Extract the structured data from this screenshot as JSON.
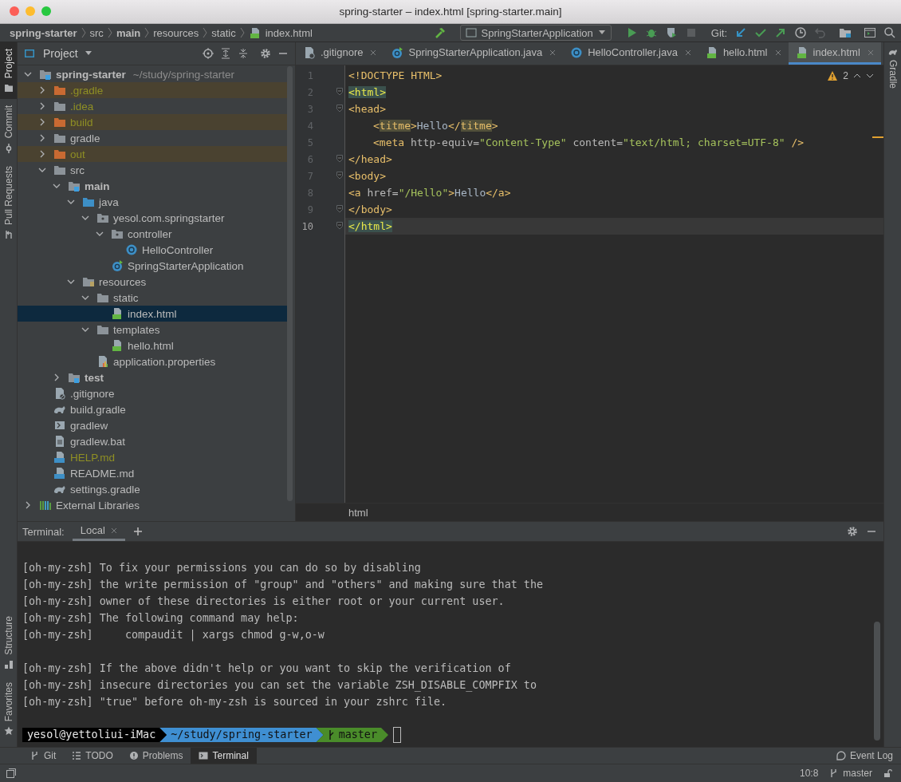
{
  "window": {
    "title": "spring-starter – index.html [spring-starter.main]"
  },
  "navbar": {
    "breadcrumbs": [
      {
        "label": "spring-starter",
        "bold": true
      },
      {
        "label": "src",
        "bold": false
      },
      {
        "label": "main",
        "bold": true
      },
      {
        "label": "resources",
        "bold": false
      },
      {
        "label": "static",
        "bold": false
      },
      {
        "label": "index.html",
        "bold": false
      }
    ],
    "run_config": "SpringStarterApplication",
    "git_label": "Git:"
  },
  "left_strip": {
    "top": [
      {
        "label": "Project",
        "selected": true
      },
      {
        "label": "Commit",
        "selected": false
      },
      {
        "label": "Pull Requests",
        "selected": false
      }
    ],
    "bottom": [
      {
        "label": "Structure",
        "selected": false
      },
      {
        "label": "Favorites",
        "selected": false
      }
    ]
  },
  "right_strip": [
    {
      "label": "Gradle",
      "selected": false
    }
  ],
  "project": {
    "title": "Project",
    "tree": [
      {
        "name": "spring-starter",
        "path": "~/study/spring-starter",
        "kind": "module",
        "expanded": true,
        "selected": false,
        "children": [
          {
            "name": ".gradle",
            "kind": "folder",
            "expanded": false,
            "excluded": true,
            "ignored": true,
            "selected": false
          },
          {
            "name": ".idea",
            "kind": "folder",
            "expanded": false,
            "excluded": false,
            "ignored": true,
            "selected": false
          },
          {
            "name": "build",
            "kind": "folder",
            "expanded": false,
            "excluded": true,
            "ignored": true,
            "selected": false
          },
          {
            "name": "gradle",
            "kind": "folder",
            "expanded": false,
            "excluded": false,
            "ignored": false,
            "selected": false
          },
          {
            "name": "out",
            "kind": "folder",
            "expanded": false,
            "excluded": true,
            "ignored": true,
            "selected": false
          },
          {
            "name": "src",
            "kind": "folder",
            "expanded": true,
            "selected": false,
            "children": [
              {
                "name": "main",
                "kind": "module",
                "expanded": true,
                "selected": false,
                "children": [
                  {
                    "name": "java",
                    "kind": "source",
                    "expanded": true,
                    "selected": false,
                    "children": [
                      {
                        "name": "yesol.com.springstarter",
                        "kind": "package",
                        "expanded": true,
                        "selected": false,
                        "children": [
                          {
                            "name": "controller",
                            "kind": "package",
                            "expanded": true,
                            "selected": false,
                            "children": [
                              {
                                "name": "HelloController",
                                "kind": "class",
                                "selected": false
                              }
                            ]
                          },
                          {
                            "name": "SpringStarterApplication",
                            "kind": "app",
                            "selected": false
                          }
                        ]
                      }
                    ]
                  },
                  {
                    "name": "resources",
                    "kind": "resources",
                    "expanded": true,
                    "selected": false,
                    "children": [
                      {
                        "name": "static",
                        "kind": "folder",
                        "expanded": true,
                        "selected": false,
                        "children": [
                          {
                            "name": "index.html",
                            "kind": "html",
                            "selected": true
                          }
                        ]
                      },
                      {
                        "name": "templates",
                        "kind": "folder",
                        "expanded": true,
                        "selected": false,
                        "children": [
                          {
                            "name": "hello.html",
                            "kind": "html",
                            "selected": false
                          }
                        ]
                      },
                      {
                        "name": "application.properties",
                        "kind": "properties",
                        "selected": false
                      }
                    ]
                  }
                ]
              },
              {
                "name": "test",
                "kind": "module",
                "expanded": false,
                "selected": false
              }
            ]
          },
          {
            "name": ".gitignore",
            "kind": "gitignore",
            "selected": false
          },
          {
            "name": "build.gradle",
            "kind": "gradle",
            "selected": false
          },
          {
            "name": "gradlew",
            "kind": "script",
            "selected": false
          },
          {
            "name": "gradlew.bat",
            "kind": "file",
            "selected": false
          },
          {
            "name": "HELP.md",
            "kind": "md",
            "ignored": true,
            "selected": false
          },
          {
            "name": "README.md",
            "kind": "md",
            "ignored": false,
            "selected": false
          },
          {
            "name": "settings.gradle",
            "kind": "gradle",
            "selected": false
          }
        ]
      },
      {
        "name": "External Libraries",
        "kind": "library",
        "expanded": false,
        "selected": false
      }
    ]
  },
  "editor": {
    "tabs": [
      {
        "label": ".gitignore",
        "kind": "gitignore",
        "selected": false
      },
      {
        "label": "SpringStarterApplication.java",
        "kind": "app",
        "selected": false
      },
      {
        "label": "HelloController.java",
        "kind": "class",
        "selected": false
      },
      {
        "label": "hello.html",
        "kind": "html",
        "selected": false
      },
      {
        "label": "index.html",
        "kind": "html",
        "selected": true
      }
    ],
    "warnings": "2",
    "lines": [
      {
        "number": "1",
        "fold": false,
        "current": false,
        "indented": false,
        "tokens": [
          {
            "text": "<!DOCTYPE HTML>",
            "kind": "tag"
          }
        ]
      },
      {
        "number": "2",
        "fold": true,
        "current": false,
        "indented": false,
        "tokens": [
          {
            "text": "<html>",
            "kind": "match"
          }
        ]
      },
      {
        "number": "3",
        "fold": true,
        "current": false,
        "indented": false,
        "tokens": [
          {
            "text": "<head>",
            "kind": "tag"
          }
        ]
      },
      {
        "number": "4",
        "fold": false,
        "current": false,
        "indented": true,
        "tokens": [
          {
            "text": "<",
            "kind": "tag"
          },
          {
            "text": "titme",
            "kind": "match"
          },
          {
            "text": ">",
            "kind": "tag"
          },
          {
            "text": "Hello",
            "kind": "text"
          },
          {
            "text": "</",
            "kind": "tag"
          },
          {
            "text": "titme",
            "kind": "match"
          },
          {
            "text": ">",
            "kind": "tag"
          }
        ]
      },
      {
        "number": "5",
        "fold": false,
        "current": false,
        "indented": true,
        "tokens": [
          {
            "text": "<meta",
            "kind": "tag"
          },
          {
            "text": " http-equiv=",
            "kind": "attr"
          },
          {
            "text": "\"Content-Type\"",
            "kind": "string"
          },
          {
            "text": " content=",
            "kind": "attr"
          },
          {
            "text": "\"text/html; charset=UTF-8\"",
            "kind": "string"
          },
          {
            "text": " />",
            "kind": "tag"
          }
        ]
      },
      {
        "number": "6",
        "fold": true,
        "current": false,
        "indented": false,
        "tokens": [
          {
            "text": "</head>",
            "kind": "tag"
          }
        ]
      },
      {
        "number": "7",
        "fold": true,
        "current": false,
        "indented": false,
        "tokens": [
          {
            "text": "<body>",
            "kind": "tag"
          }
        ]
      },
      {
        "number": "8",
        "fold": false,
        "current": false,
        "indented": false,
        "tokens": [
          {
            "text": "<a",
            "kind": "tag"
          },
          {
            "text": " href=",
            "kind": "attr"
          },
          {
            "text": "\"/Hello\"",
            "kind": "string"
          },
          {
            "text": ">",
            "kind": "tag"
          },
          {
            "text": "Hello",
            "kind": "text"
          },
          {
            "text": "</a>",
            "kind": "tag"
          }
        ]
      },
      {
        "number": "9",
        "fold": true,
        "current": false,
        "indented": false,
        "tokens": [
          {
            "text": "</body>",
            "kind": "tag"
          }
        ]
      },
      {
        "number": "10",
        "fold": true,
        "current": true,
        "indented": false,
        "tokens": [
          {
            "text": "</html>",
            "kind": "match"
          }
        ]
      }
    ],
    "breadcrumb": "html"
  },
  "terminal": {
    "label": "Terminal:",
    "tabs": [
      {
        "label": "Local",
        "selected": true
      }
    ],
    "paragraphs": [
      [
        "[oh-my-zsh] To fix your permissions you can do so by disabling",
        "[oh-my-zsh] the write permission of \"group\" and \"others\" and making sure that the",
        "[oh-my-zsh] owner of these directories is either root or your current user.",
        "[oh-my-zsh] The following command may help:",
        "[oh-my-zsh]     compaudit | xargs chmod g-w,o-w"
      ],
      [
        "[oh-my-zsh] If the above didn't help or you want to skip the verification of",
        "[oh-my-zsh] insecure directories you can set the variable ZSH_DISABLE_COMPFIX to",
        "[oh-my-zsh] \"true\" before oh-my-zsh is sourced in your zshrc file."
      ]
    ],
    "prompt": {
      "user": "yesol@yettoliui-iMac",
      "path": "~/study/spring-starter",
      "branch": "master"
    }
  },
  "tool_windows": [
    {
      "label": "Git",
      "selected": false
    },
    {
      "label": "TODO",
      "selected": false
    },
    {
      "label": "Problems",
      "selected": false
    },
    {
      "label": "Terminal",
      "selected": true
    }
  ],
  "event_log": "Event Log",
  "status_bar": {
    "position": "10:8",
    "branch": "master"
  }
}
